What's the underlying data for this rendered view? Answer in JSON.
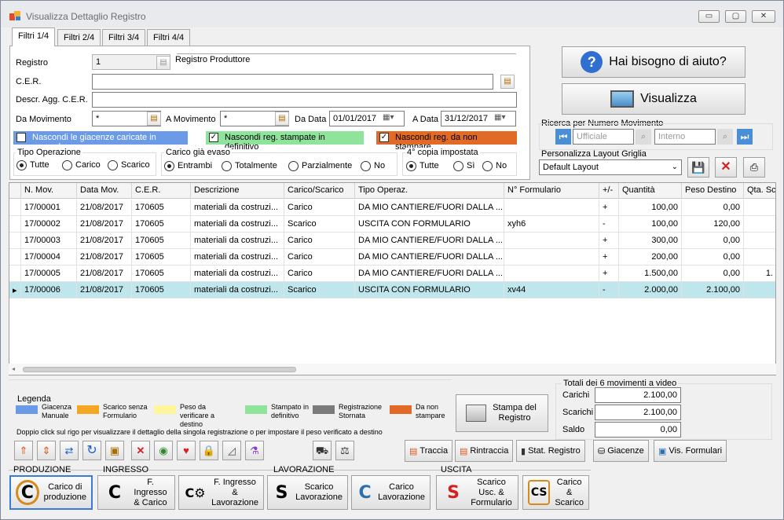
{
  "window": {
    "title": "Visualizza Dettaglio Registro",
    "min": "▭",
    "restore": "▢",
    "close": "✕"
  },
  "tabs": [
    {
      "label": "Filtri 1/4"
    },
    {
      "label": "Filtri 2/4"
    },
    {
      "label": "Filtri 3/4"
    },
    {
      "label": "Filtri 4/4"
    }
  ],
  "filters": {
    "registro_label": "Registro",
    "registro_value": "1",
    "registro_name": "Registro Produttore",
    "cer_label": "C.E.R.",
    "cer_value": "",
    "descr_label": "Descr. Agg. C.E.R.",
    "descr_value": "",
    "da_mov_label": "Da Movimento",
    "da_mov_value": "*",
    "a_mov_label": "A Movimento",
    "a_mov_value": "*",
    "da_data_label": "Da Data",
    "da_data_value": "01/01/2017",
    "a_data_label": "A Data",
    "a_data_value": "31/12/2017",
    "chk1": "Nascondi le giacenze caricate in manuale",
    "chk2": "Nascondi reg. stampate in definitivo",
    "chk3": "Nascondi reg. da non stampare",
    "tipo_op": {
      "title": "Tipo Operazione",
      "opts": [
        "Tutte",
        "Carico",
        "Scarico"
      ]
    },
    "evaso": {
      "title": "Carico già evaso",
      "opts": [
        "Entrambi",
        "Totalmente",
        "Parzialmente",
        "No"
      ]
    },
    "copia": {
      "title": "4° copia impostata",
      "opts": [
        "Tutte",
        "Sì",
        "No"
      ]
    }
  },
  "help_button": "Hai bisogno di aiuto?",
  "visualizza_button": "Visualizza",
  "ricerca": {
    "title": "Ricerca per Numero Movimento",
    "ufficiale_ph": "Ufficiale",
    "interno_ph": "Interno"
  },
  "layout": {
    "title": "Personalizza Layout Griglia",
    "value": "Default Layout"
  },
  "grid": {
    "columns": [
      "N. Mov.",
      "Data Mov.",
      "C.E.R.",
      "Descrizione",
      "Carico/Scarico",
      "Tipo Operaz.",
      "N° Formulario",
      "+/-",
      "Quantità",
      "Peso Destino",
      "Qta. Sc"
    ],
    "rows": [
      [
        "17/00001",
        "21/08/2017",
        "170605",
        "materiali da costruzi...",
        "Carico",
        "DA MIO CANTIERE/FUORI DALLA ...",
        "",
        "+",
        "100,00",
        "0,00",
        ""
      ],
      [
        "17/00002",
        "21/08/2017",
        "170605",
        "materiali da costruzi...",
        "Scarico",
        "USCITA CON FORMULARIO",
        "xyh6",
        "-",
        "100,00",
        "120,00",
        ""
      ],
      [
        "17/00003",
        "21/08/2017",
        "170605",
        "materiali da costruzi...",
        "Carico",
        "DA MIO CANTIERE/FUORI DALLA ...",
        "",
        "+",
        "300,00",
        "0,00",
        ""
      ],
      [
        "17/00004",
        "21/08/2017",
        "170605",
        "materiali da costruzi...",
        "Carico",
        "DA MIO CANTIERE/FUORI DALLA ...",
        "",
        "+",
        "200,00",
        "0,00",
        ""
      ],
      [
        "17/00005",
        "21/08/2017",
        "170605",
        "materiali da costruzi...",
        "Carico",
        "DA MIO CANTIERE/FUORI DALLA ...",
        "",
        "+",
        "1.500,00",
        "0,00",
        "1."
      ],
      [
        "17/00006",
        "21/08/2017",
        "170605",
        "materiali da costruzi...",
        "Scarico",
        "USCITA CON FORMULARIO",
        "xv44",
        "-",
        "2.000,00",
        "2.100,00",
        ""
      ]
    ],
    "selected_marker": "▸"
  },
  "legend": {
    "title": "Legenda",
    "items": [
      {
        "color": "#6b9be6",
        "text": "Giacenza Manuale"
      },
      {
        "color": "#f5a623",
        "text": "Scarico senza Formulario"
      },
      {
        "color": "#fff59a",
        "text": "Peso da verificare a destino"
      },
      {
        "color": "#8fe39b",
        "text": "Stampato in definitivo"
      },
      {
        "color": "#7a7a7a",
        "text": "Registrazione Stornata"
      },
      {
        "color": "#e06a26",
        "text": "Da non stampare"
      }
    ]
  },
  "stampa_button": "Stampa del Registro",
  "totals": {
    "title": "Totali dei 6 movimenti a video",
    "carichi_label": "Carichi",
    "carichi": "2.100,00",
    "scarichi_label": "Scarichi",
    "scarichi": "2.100,00",
    "saldo_label": "Saldo",
    "saldo": "0,00"
  },
  "hint": "Doppio click sul rigo per visualizzare il dettaglio della singola registrazione o per impostare il peso verificato a destino",
  "actions": {
    "traccia": "Traccia",
    "rintraccia": "Rintraccia",
    "stat": "Stat. Registro",
    "giacenze": "Giacenze",
    "formulari": "Vis. Formulari"
  },
  "sections": {
    "produzione": {
      "title": "PRODUZIONE",
      "btn": "Carico di produzione",
      "icon": "C"
    },
    "ingresso": {
      "title": "INGRESSO",
      "btn1": "F. Ingresso & Carico",
      "btn2": "F. Ingresso & Lavorazione"
    },
    "lavorazione": {
      "title": "LAVORAZIONE",
      "btn1": "Scarico Lavorazione",
      "btn2": "Carico Lavorazione"
    },
    "uscita": {
      "title": "USCITA",
      "btn1": "Scarico Usc. & Formulario",
      "btn2": "Carico & Scarico"
    }
  },
  "colors": {
    "chk_blue": "#6b9be6",
    "chk_green": "#8fe39b",
    "chk_orange": "#e06a26",
    "selected_row": "#bfe6ed"
  }
}
